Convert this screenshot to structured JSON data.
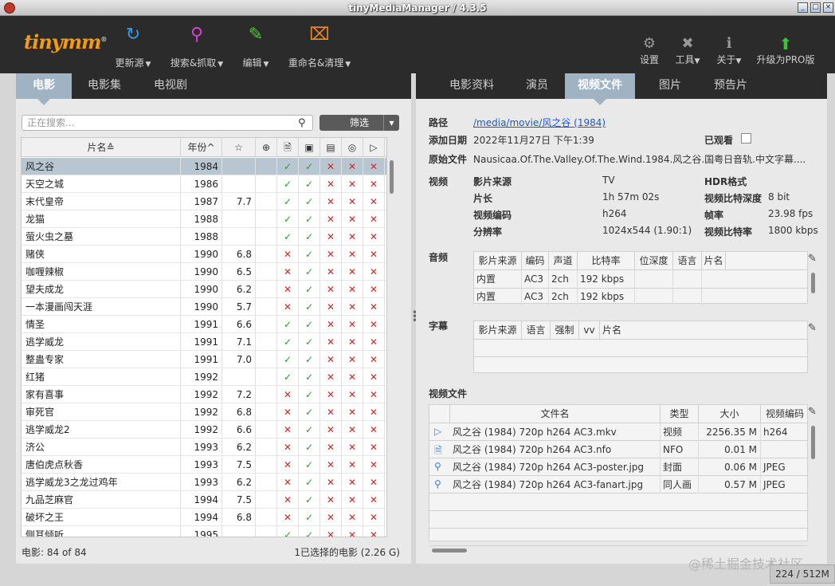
{
  "window": {
    "title": "tinyMediaManager / 4.3.5"
  },
  "toolbar": {
    "logo": "tinymm",
    "update_label": "更新源",
    "search_label": "搜索&抓取",
    "edit_label": "编辑",
    "rename_label": "重命名&清理",
    "settings_label": "设置",
    "tools_label": "工具",
    "about_label": "关于",
    "upgrade_label": "升级为PRO版"
  },
  "left_tabs": [
    "电影",
    "电影集",
    "电视剧"
  ],
  "search": {
    "placeholder": "正在搜索...",
    "filter_label": "筛选"
  },
  "movie_table": {
    "headers": {
      "title": "片名",
      "year": "年份"
    },
    "rows": [
      {
        "title": "风之谷",
        "year": "1984",
        "rating": "",
        "c": [
          "ok",
          "ok",
          "no",
          "no",
          "no"
        ]
      },
      {
        "title": "天空之城",
        "year": "1986",
        "rating": "",
        "c": [
          "ok",
          "ok",
          "no",
          "no",
          "no"
        ]
      },
      {
        "title": "末代皇帝",
        "year": "1987",
        "rating": "7.7",
        "c": [
          "ok",
          "ok",
          "no",
          "no",
          "no"
        ]
      },
      {
        "title": "龙猫",
        "year": "1988",
        "rating": "",
        "c": [
          "ok",
          "ok",
          "no",
          "no",
          "no"
        ]
      },
      {
        "title": "萤火虫之墓",
        "year": "1988",
        "rating": "",
        "c": [
          "ok",
          "ok",
          "no",
          "no",
          "no"
        ]
      },
      {
        "title": "赌侠",
        "year": "1990",
        "rating": "6.8",
        "c": [
          "no",
          "ok",
          "no",
          "no",
          "no"
        ]
      },
      {
        "title": "咖喱辣椒",
        "year": "1990",
        "rating": "6.5",
        "c": [
          "no",
          "ok",
          "no",
          "no",
          "no"
        ]
      },
      {
        "title": "望夫成龙",
        "year": "1990",
        "rating": "6.2",
        "c": [
          "no",
          "ok",
          "no",
          "no",
          "no"
        ]
      },
      {
        "title": "一本漫画闯天涯",
        "year": "1990",
        "rating": "5.7",
        "c": [
          "no",
          "ok",
          "no",
          "no",
          "no"
        ]
      },
      {
        "title": "情圣",
        "year": "1991",
        "rating": "6.6",
        "c": [
          "ok",
          "ok",
          "no",
          "no",
          "no"
        ]
      },
      {
        "title": "逃学威龙",
        "year": "1991",
        "rating": "7.1",
        "c": [
          "ok",
          "ok",
          "no",
          "no",
          "no"
        ]
      },
      {
        "title": "整蛊专家",
        "year": "1991",
        "rating": "7.0",
        "c": [
          "ok",
          "ok",
          "no",
          "no",
          "no"
        ]
      },
      {
        "title": "红猪",
        "year": "1992",
        "rating": "",
        "c": [
          "ok",
          "ok",
          "no",
          "no",
          "no"
        ]
      },
      {
        "title": "家有喜事",
        "year": "1992",
        "rating": "7.2",
        "c": [
          "no",
          "ok",
          "no",
          "no",
          "no"
        ]
      },
      {
        "title": "审死官",
        "year": "1992",
        "rating": "6.8",
        "c": [
          "no",
          "ok",
          "no",
          "no",
          "no"
        ]
      },
      {
        "title": "逃学威龙2",
        "year": "1992",
        "rating": "6.6",
        "c": [
          "no",
          "ok",
          "no",
          "no",
          "no"
        ]
      },
      {
        "title": "济公",
        "year": "1993",
        "rating": "6.2",
        "c": [
          "no",
          "ok",
          "no",
          "no",
          "no"
        ]
      },
      {
        "title": "唐伯虎点秋香",
        "year": "1993",
        "rating": "7.5",
        "c": [
          "no",
          "ok",
          "no",
          "no",
          "no"
        ]
      },
      {
        "title": "逃学威龙3之龙过鸡年",
        "year": "1993",
        "rating": "6.2",
        "c": [
          "no",
          "ok",
          "no",
          "no",
          "no"
        ]
      },
      {
        "title": "九品芝麻官",
        "year": "1994",
        "rating": "7.5",
        "c": [
          "no",
          "ok",
          "no",
          "no",
          "no"
        ]
      },
      {
        "title": "破坏之王",
        "year": "1994",
        "rating": "6.8",
        "c": [
          "no",
          "ok",
          "no",
          "no",
          "no"
        ]
      },
      {
        "title": "侧耳倾听",
        "year": "1995",
        "rating": "",
        "c": [
          "ok",
          "ok",
          "no",
          "no",
          "no"
        ]
      }
    ]
  },
  "left_status": {
    "count": "电影:  84  of  84",
    "selected": "1已选择的电影 (2.26 G)"
  },
  "right_tabs": [
    "电影资料",
    "演员",
    "视频文件",
    "图片",
    "预告片"
  ],
  "details": {
    "path_label": "路径",
    "path": "/media/movie/风之谷 (1984)",
    "added_label": "添加日期",
    "added": "2022年11月27日 下午1:39",
    "watched_label": "已观看",
    "orig_label": "原始文件",
    "orig": "Nausicaa.Of.The.Valley.Of.The.Wind.1984.风之谷.国粤日音轨.中文字幕....",
    "video_label": "视频",
    "source_label": "影片来源",
    "source": "TV",
    "hdr_label": "HDR格式",
    "duration_label": "片长",
    "duration": "1h 57m 02s",
    "bitdepth_label": "视频比特深度",
    "bitdepth": "8 bit",
    "codec_label": "视频编码",
    "codec": "h264",
    "fps_label": "帧率",
    "fps": "23.98 fps",
    "res_label": "分辨率",
    "res": "1024x544 (1.90:1)",
    "bitrate_label": "视频比特率",
    "bitrate": "1800 kbps"
  },
  "audio": {
    "label": "音频",
    "headers": [
      "影片来源",
      "编码",
      "声道",
      "比特率",
      "位深度",
      "语言",
      "片名"
    ],
    "rows": [
      [
        "内置",
        "AC3",
        "2ch",
        "192 kbps",
        "",
        "",
        ""
      ],
      [
        "内置",
        "AC3",
        "2ch",
        "192 kbps",
        "",
        "",
        ""
      ]
    ]
  },
  "subtitles": {
    "label": "字幕",
    "headers": [
      "影片来源",
      "语言",
      "强制",
      "vv",
      "片名"
    ]
  },
  "video_files": {
    "label": "视频文件",
    "headers": [
      "文件名",
      "类型",
      "大小",
      "视频编码"
    ],
    "rows": [
      {
        "icon": "play-icon",
        "name": "风之谷 (1984) 720p h264 AC3.mkv",
        "type": "视频",
        "size": "2256.35 M",
        "codec": "h264"
      },
      {
        "icon": "document-icon",
        "name": "风之谷 (1984) 720p h264 AC3.nfo",
        "type": "NFO",
        "size": "0.01 M",
        "codec": ""
      },
      {
        "icon": "magnifier-icon",
        "name": "风之谷 (1984) 720p h264 AC3-poster.jpg",
        "type": "封面",
        "size": "0.06 M",
        "codec": "JPEG"
      },
      {
        "icon": "magnifier-icon",
        "name": "风之谷 (1984) 720p h264 AC3-fanart.jpg",
        "type": "同人画",
        "size": "0.57 M",
        "codec": "JPEG"
      }
    ]
  },
  "memory": "224 / 512M",
  "watermark": "@稀土掘金技术社区"
}
